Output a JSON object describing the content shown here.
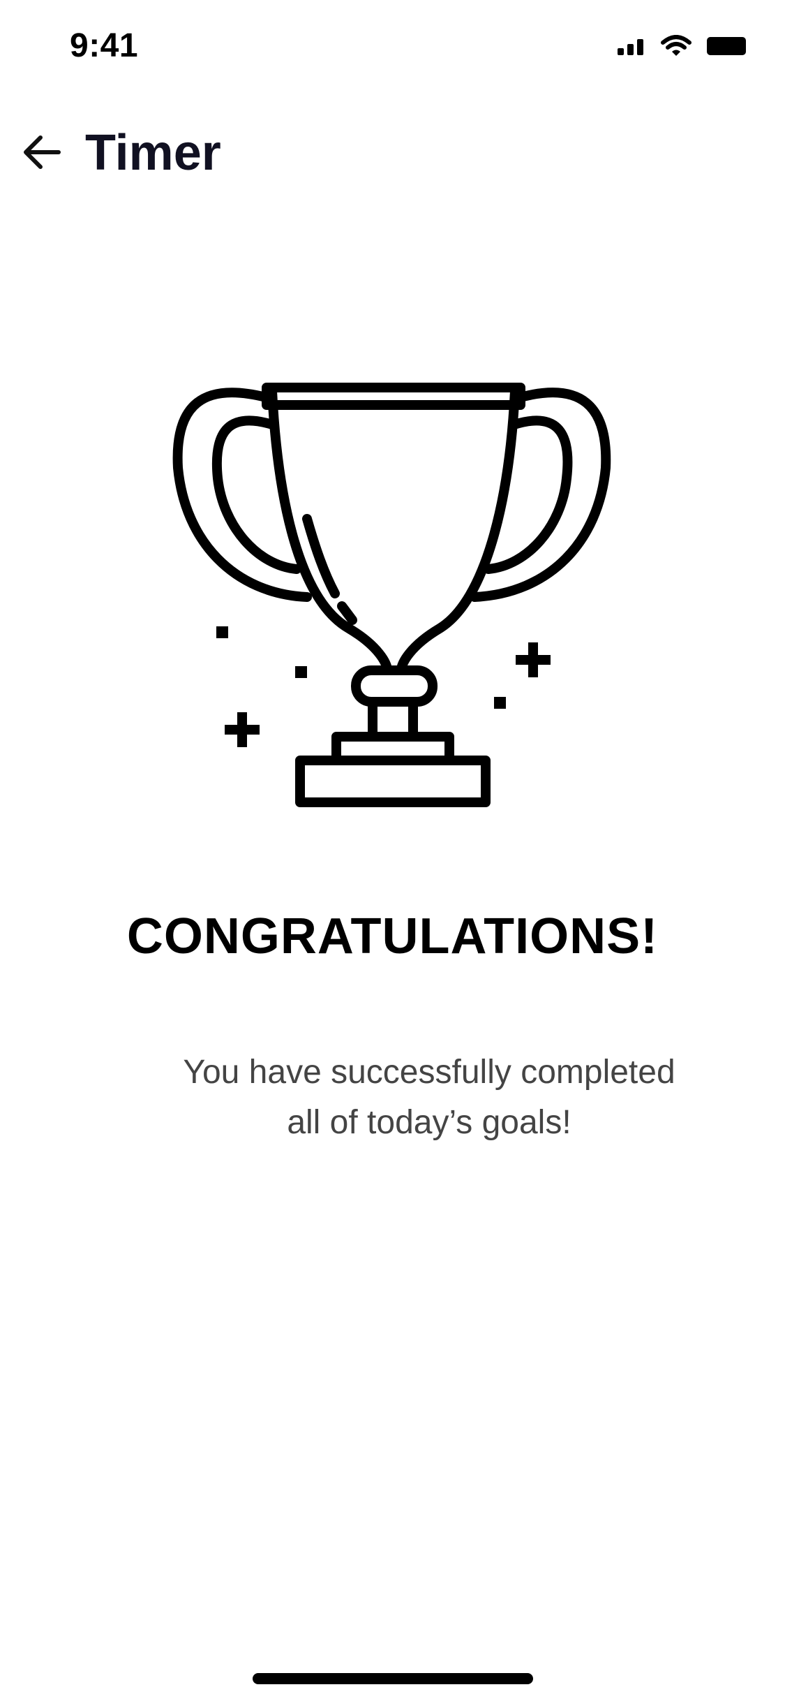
{
  "status_bar": {
    "time": "9:41",
    "icons": [
      "cellular-signal-icon",
      "wifi-icon",
      "battery-icon"
    ]
  },
  "header": {
    "back_icon": "arrow-left-icon",
    "title": "Timer"
  },
  "illustration": {
    "icon": "trophy-icon"
  },
  "content": {
    "heading": "CONGRATULATIONS!",
    "message": "You have successfully completed\nall of today’s goals!"
  },
  "colors": {
    "background": "#ffffff",
    "title": "#111122",
    "message": "#444444"
  }
}
